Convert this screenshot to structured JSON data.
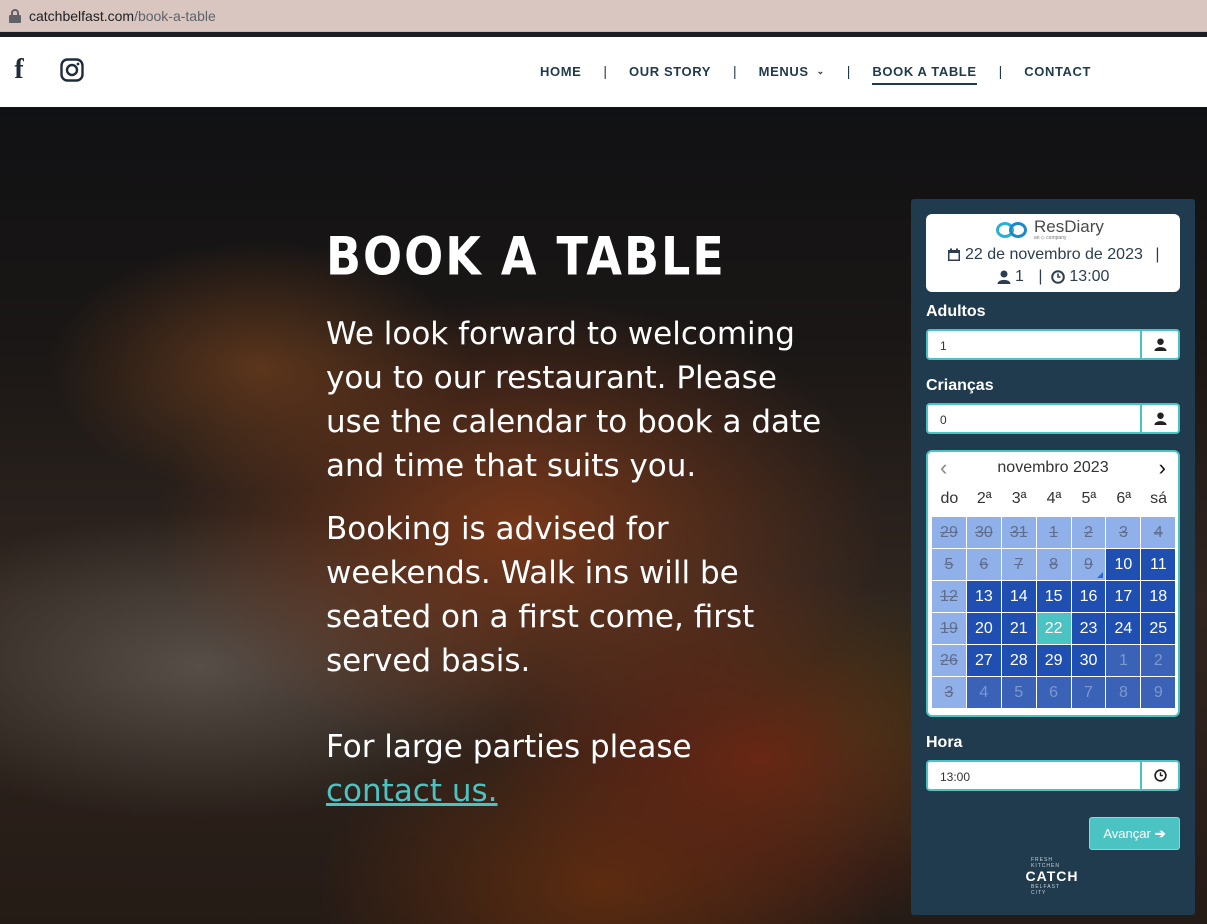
{
  "browser": {
    "url_host": "catchbelfast.com",
    "url_path": "/book-a-table"
  },
  "social": {
    "facebook": "facebook-icon",
    "instagram": "instagram-icon"
  },
  "nav": {
    "home": "HOME",
    "our_story": "OUR STORY",
    "menus": "MENUS",
    "book_a_table": "BOOK A TABLE",
    "contact": "CONTACT",
    "separator": "|"
  },
  "hero": {
    "title": "BOOK A TABLE",
    "p1": "We look forward to welcoming you to our restaurant. Please use the calendar to book a date and time that suits you.",
    "p2": "Booking is advised for weekends. Walk ins will be seated on a first come, first served basis.",
    "p3_prefix": "For large parties please",
    "p3_link": "contact us."
  },
  "widget": {
    "brand": "ResDiary",
    "brand_sub": "an ◇ company",
    "summary_date": "22 de novembro de 2023",
    "summary_sep": "|",
    "summary_guests": "1",
    "summary_time": "13:00",
    "adults_label": "Adultos",
    "adults_value": "1",
    "children_label": "Crianças",
    "children_value": "0",
    "calendar": {
      "month": "novembro 2023",
      "weekdays": [
        "do",
        "2ª",
        "3ª",
        "4ª",
        "5ª",
        "6ª",
        "sá"
      ],
      "days": [
        {
          "d": "29",
          "s": "past"
        },
        {
          "d": "30",
          "s": "past"
        },
        {
          "d": "31",
          "s": "past"
        },
        {
          "d": "1",
          "s": "past"
        },
        {
          "d": "2",
          "s": "past"
        },
        {
          "d": "3",
          "s": "past"
        },
        {
          "d": "4",
          "s": "past"
        },
        {
          "d": "5",
          "s": "past"
        },
        {
          "d": "6",
          "s": "past"
        },
        {
          "d": "7",
          "s": "past"
        },
        {
          "d": "8",
          "s": "past"
        },
        {
          "d": "9",
          "s": "past-today"
        },
        {
          "d": "10",
          "s": "avail"
        },
        {
          "d": "11",
          "s": "avail"
        },
        {
          "d": "12",
          "s": "past"
        },
        {
          "d": "13",
          "s": "avail"
        },
        {
          "d": "14",
          "s": "avail"
        },
        {
          "d": "15",
          "s": "avail"
        },
        {
          "d": "16",
          "s": "avail"
        },
        {
          "d": "17",
          "s": "avail"
        },
        {
          "d": "18",
          "s": "avail"
        },
        {
          "d": "19",
          "s": "past"
        },
        {
          "d": "20",
          "s": "avail"
        },
        {
          "d": "21",
          "s": "avail"
        },
        {
          "d": "22",
          "s": "sel"
        },
        {
          "d": "23",
          "s": "avail"
        },
        {
          "d": "24",
          "s": "avail"
        },
        {
          "d": "25",
          "s": "avail"
        },
        {
          "d": "26",
          "s": "past"
        },
        {
          "d": "27",
          "s": "avail"
        },
        {
          "d": "28",
          "s": "avail"
        },
        {
          "d": "29",
          "s": "avail"
        },
        {
          "d": "30",
          "s": "avail"
        },
        {
          "d": "1",
          "s": "next"
        },
        {
          "d": "2",
          "s": "next"
        },
        {
          "d": "3",
          "s": "past"
        },
        {
          "d": "4",
          "s": "next"
        },
        {
          "d": "5",
          "s": "next"
        },
        {
          "d": "6",
          "s": "next"
        },
        {
          "d": "7",
          "s": "next"
        },
        {
          "d": "8",
          "s": "next"
        },
        {
          "d": "9",
          "s": "next"
        }
      ]
    },
    "time_label": "Hora",
    "time_value": "13:00",
    "next_button": "Avançar",
    "footer_logo": {
      "top": "FRESH KITCHEN",
      "name": "CATCH",
      "bottom": "BELFAST CITY"
    }
  },
  "colors": {
    "accent": "#4cc3c3",
    "widget_bg": "#213b4e",
    "available": "#1f4fb0",
    "past": "#8fb0e8"
  }
}
